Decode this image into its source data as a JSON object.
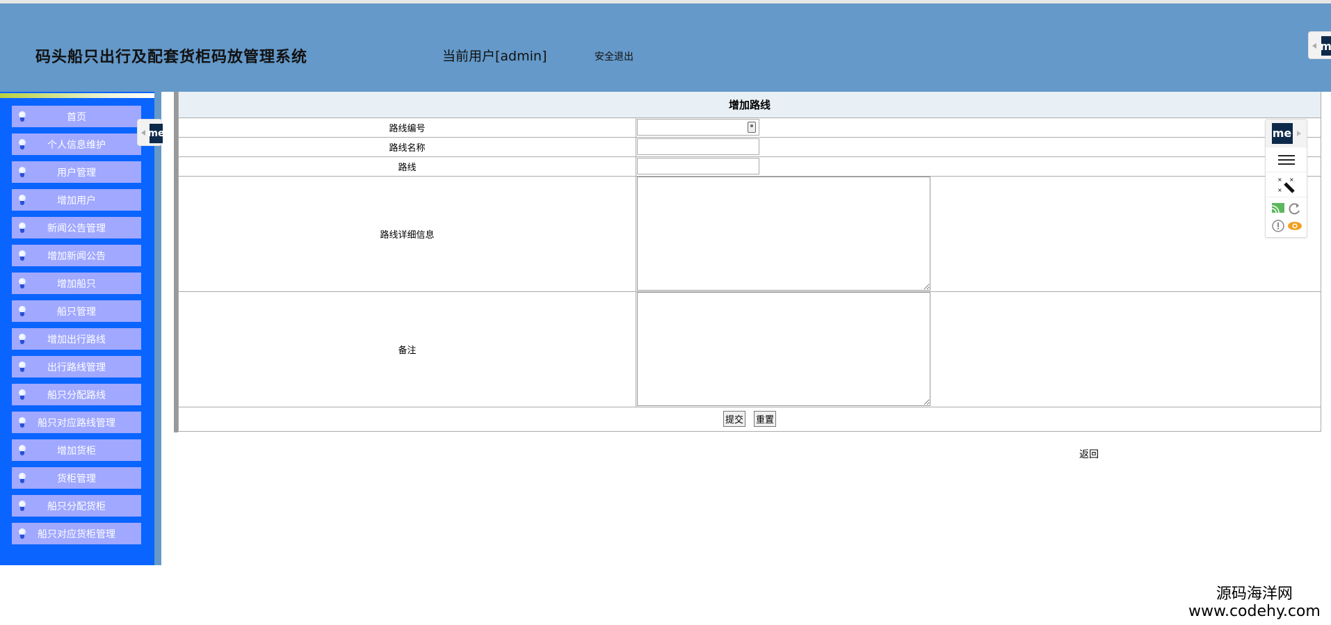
{
  "header": {
    "title": "码头船只出行及配套货柜码放管理系统",
    "current_user": "当前用户[admin]",
    "logout": "安全退出"
  },
  "sidebar": {
    "items": [
      {
        "label": "首页"
      },
      {
        "label": "个人信息维护"
      },
      {
        "label": "用户管理"
      },
      {
        "label": "增加用户"
      },
      {
        "label": "新闻公告管理"
      },
      {
        "label": "增加新闻公告"
      },
      {
        "label": "增加船只"
      },
      {
        "label": "船只管理"
      },
      {
        "label": "增加出行路线"
      },
      {
        "label": "出行路线管理"
      },
      {
        "label": "船只分配路线"
      },
      {
        "label": "船只对应路线管理"
      },
      {
        "label": "增加货柜"
      },
      {
        "label": "货柜管理"
      },
      {
        "label": "船只分配货柜"
      },
      {
        "label": "船只对应货柜管理"
      }
    ]
  },
  "form": {
    "title": "增加路线",
    "fields": {
      "route_no": {
        "label": "路线编号",
        "value": ""
      },
      "route_name": {
        "label": "路线名称",
        "value": ""
      },
      "route": {
        "label": "路线",
        "value": ""
      },
      "details": {
        "label": "路线详细信息",
        "value": ""
      },
      "remark": {
        "label": "备注",
        "value": ""
      }
    },
    "submit": "提交",
    "reset": "重置"
  },
  "back": "返回",
  "watermark": {
    "line1": "源码海洋网",
    "line2": "www.codehy.com"
  },
  "extension": {
    "logo": "me",
    "colors": {
      "logo_bg": "#0d2a4a",
      "cast": "#5cb85c",
      "eye": "#f0a020"
    }
  },
  "colors": {
    "header": "#6499c9",
    "sidebar": "#0a64ff",
    "nav_item": "#a0a8ff"
  }
}
